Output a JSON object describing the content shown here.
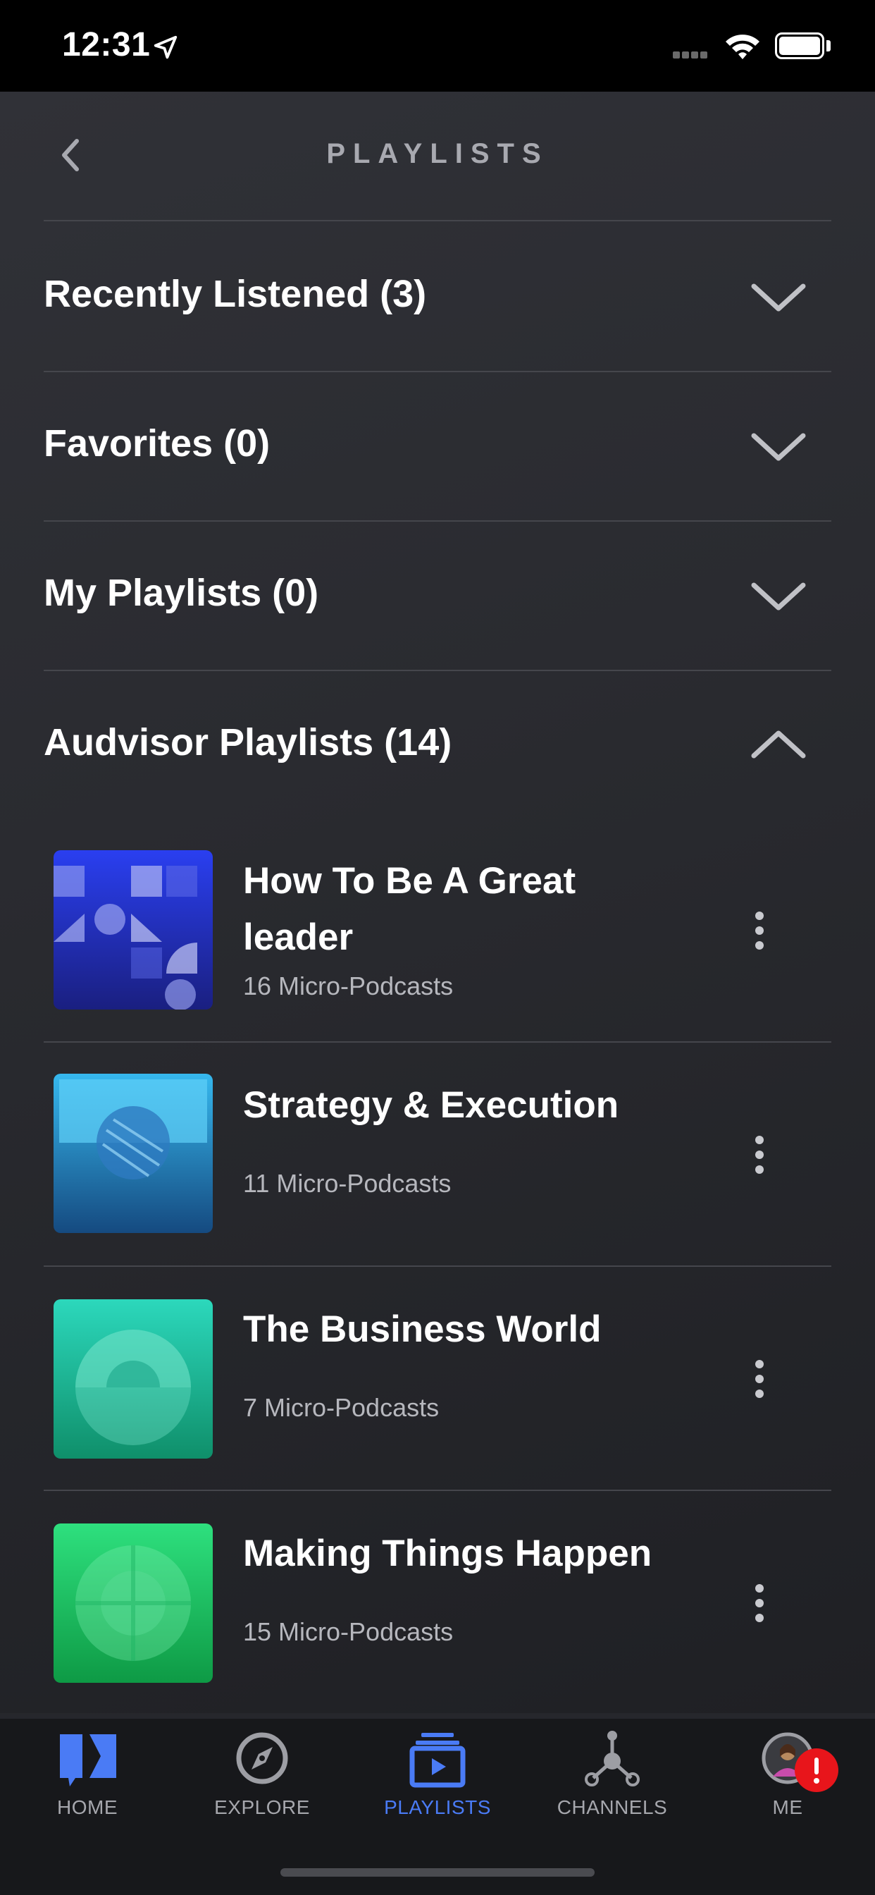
{
  "status_bar": {
    "time": "12:31"
  },
  "header": {
    "title": "PLAYLISTS"
  },
  "sections": [
    {
      "label": "Recently Listened (3)",
      "expanded": false
    },
    {
      "label": "Favorites (0)",
      "expanded": false
    },
    {
      "label": "My Playlists (0)",
      "expanded": false
    },
    {
      "label": "Audvisor Playlists (14)",
      "expanded": true
    }
  ],
  "playlists": [
    {
      "title_line1": "How To Be A Great",
      "title_line2": "leader",
      "subtitle": "16 Micro-Podcasts",
      "color": "#2436d0"
    },
    {
      "title": "Strategy & Execution",
      "subtitle": "11 Micro-Podcasts",
      "color": "#2a8fd0"
    },
    {
      "title": "The Business World",
      "subtitle": "7 Micro-Podcasts",
      "color": "#1fc4a8"
    },
    {
      "title": "Making Things Happen",
      "subtitle": "15 Micro-Podcasts",
      "color": "#1ec46a"
    }
  ],
  "tabs": [
    {
      "label": "HOME",
      "icon": "home-icon"
    },
    {
      "label": "EXPLORE",
      "icon": "compass-icon"
    },
    {
      "label": "PLAYLISTS",
      "icon": "playlists-icon",
      "active": true
    },
    {
      "label": "CHANNELS",
      "icon": "channels-icon"
    },
    {
      "label": "ME",
      "icon": "avatar-icon",
      "badge": "!"
    }
  ],
  "colors": {
    "accent": "#4a7bf5",
    "background": "#26272c",
    "badge": "#e8151b"
  }
}
